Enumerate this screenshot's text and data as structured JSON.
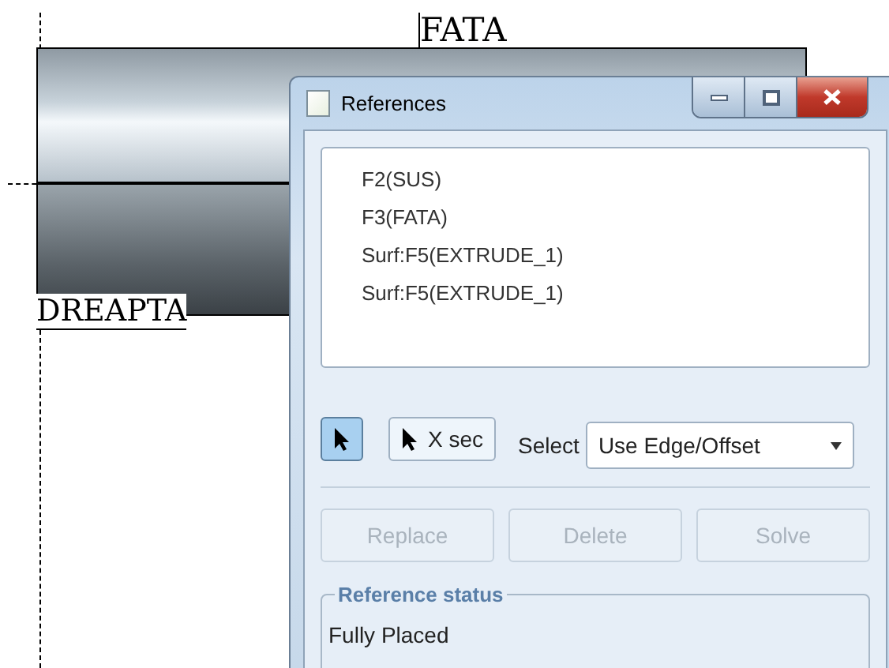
{
  "canvas": {
    "top_label": "FATA",
    "bottom_label": "DREAPTA"
  },
  "dialog": {
    "title": "References",
    "references": [
      "F2(SUS)",
      "F3(FATA)",
      "Surf:F5(EXTRUDE_1)",
      "Surf:F5(EXTRUDE_1)"
    ],
    "tools": [
      {
        "kind": "pointer",
        "selected": true
      },
      {
        "kind": "xsec",
        "label": "X sec",
        "selected": false
      }
    ],
    "select": {
      "label": "Select",
      "value": "Use Edge/Offset"
    },
    "actions": [
      {
        "label": "Replace",
        "disabled": true
      },
      {
        "label": "Delete",
        "disabled": true
      },
      {
        "label": "Solve",
        "disabled": true
      }
    ],
    "status": {
      "title": "Reference status",
      "text": "Fully Placed"
    }
  }
}
